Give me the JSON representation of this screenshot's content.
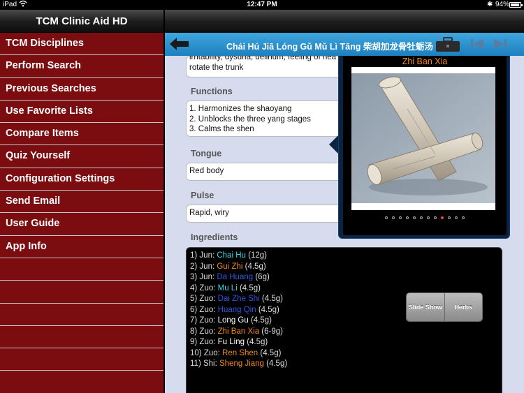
{
  "status_bar": {
    "carrier": "iPad",
    "time": "12:47 PM",
    "battery_pct": "94%",
    "battery_level": 0.94
  },
  "master": {
    "title": "TCM Clinic Aid HD",
    "menu": [
      "TCM Disciplines",
      "Perform Search",
      "Previous Searches",
      "Use Favorite Lists",
      "Compare Items",
      "Quiz Yourself",
      "Configuration Settings",
      "Send Email",
      "User Guide",
      "App Info",
      "",
      "",
      "",
      "",
      "",
      ""
    ]
  },
  "detail": {
    "nav_title": "Chái Hú Jiā Lóng Gǔ Mǔ Lì Tāng 柴胡加龙骨牡蛎汤",
    "top_text": "irritability, dysuria, delirium, feeling of hea",
    "top_text_2": "rotate the trunk",
    "functions_label": "Functions",
    "functions": [
      "1. Harmonizes the shaoyang",
      "2. Unblocks the three yang stages",
      "3. Calms the shen"
    ],
    "tongue_label": "Tongue",
    "tongue": "Red body",
    "pulse_label": "Pulse",
    "pulse": "Rapid, wiry",
    "ingredients_label": "Ingredients",
    "ingredients": [
      {
        "prefix": "1) Jun: ",
        "name": "Chai Hu",
        "dose": " (12g)",
        "color": "#3fd3e6"
      },
      {
        "prefix": "2) Jun: ",
        "name": "Gui Zhi",
        "dose": " (4.5g)",
        "color": "#f08a1a"
      },
      {
        "prefix": "3) Jun: ",
        "name": "Da Huang",
        "dose": " (6g)",
        "color": "#2f55e0"
      },
      {
        "prefix": "4) Zuo: ",
        "name": "Mu Li",
        "dose": " (4.5g)",
        "color": "#3fd3e6"
      },
      {
        "prefix": "5) Zuo: ",
        "name": "Dai Zhe Shi",
        "dose": " (4.5g)",
        "color": "#2f55e0"
      },
      {
        "prefix": "6) Zuo: ",
        "name": "Huang Qin",
        "dose": " (4.5g)",
        "color": "#2f55e0"
      },
      {
        "prefix": "7) Zuo: ",
        "name": "Long Gu",
        "dose": " (4.5g)",
        "color": "#ffffff"
      },
      {
        "prefix": "8) Zuo: ",
        "name": "Zhi Ban Xia",
        "dose": " (6-9g)",
        "color": "#f08a1a"
      },
      {
        "prefix": "9) Zuo: ",
        "name": "Fu Ling",
        "dose": " (4.5g)",
        "color": "#ffffff"
      },
      {
        "prefix": "10) Zuo: ",
        "name": "Ren Shen",
        "dose": " (4.5g)",
        "color": "#f08a1a"
      },
      {
        "prefix": "11) Shi: ",
        "name": "Sheng Jiang",
        "dose": " (4.5g)",
        "color": "#f08a1a"
      }
    ],
    "buttons": {
      "slideshow": "Slide Show",
      "herbs": "Herbs"
    }
  },
  "popover": {
    "title": "Zhi Ban Xia",
    "page_count": 12,
    "active_page": 8
  }
}
